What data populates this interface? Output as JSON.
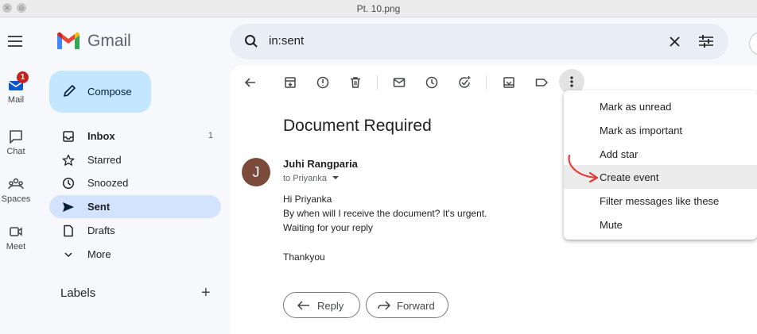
{
  "window": {
    "title": "Pt. 10.png"
  },
  "app": {
    "name": "Gmail"
  },
  "rail": [
    {
      "label": "Mail",
      "icon": "mail-icon",
      "badge": "1"
    },
    {
      "label": "Chat",
      "icon": "chat-icon"
    },
    {
      "label": "Spaces",
      "icon": "spaces-icon"
    },
    {
      "label": "Meet",
      "icon": "meet-icon"
    }
  ],
  "search": {
    "value": "in:sent"
  },
  "compose": {
    "label": "Compose"
  },
  "nav": [
    {
      "label": "Inbox",
      "icon": "inbox-icon",
      "count": "1"
    },
    {
      "label": "Starred",
      "icon": "star-icon"
    },
    {
      "label": "Snoozed",
      "icon": "clock-icon"
    },
    {
      "label": "Sent",
      "icon": "send-icon"
    },
    {
      "label": "Drafts",
      "icon": "draft-icon"
    },
    {
      "label": "More",
      "icon": "chevron-down-icon"
    }
  ],
  "labels": {
    "heading": "Labels",
    "add": "+"
  },
  "email": {
    "subject": "Document Required",
    "avatar_letter": "J",
    "sender": "Juhi Rangparia",
    "to": "to Priyanka",
    "body": [
      "Hi Priyanka",
      "By when will I receive the document? It's urgent.",
      "Waiting for your reply",
      "Thankyou"
    ]
  },
  "actions": {
    "reply": "Reply",
    "forward": "Forward"
  },
  "menu": {
    "items": [
      "Mark as unread",
      "Mark as important",
      "Add star",
      "Create event",
      "Filter messages like these",
      "Mute"
    ],
    "highlighted": "Create event"
  },
  "colors": {
    "accent_arrow": "#e53935",
    "sent_active": "#d3e3fd",
    "compose": "#c2e7ff"
  }
}
